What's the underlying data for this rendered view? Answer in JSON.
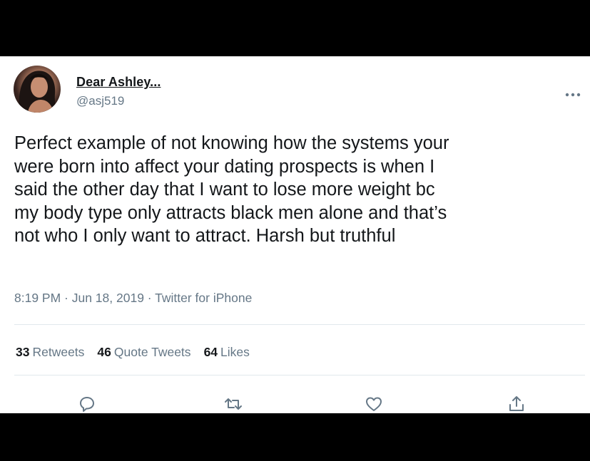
{
  "user": {
    "display_name": "Dear Ashley...",
    "handle": "@asj519"
  },
  "tweet": {
    "text": "Perfect example of not knowing how the systems your\nwere born into affect your dating prospects is when I\nsaid the other day that I want to lose more weight bc\nmy body type only attracts black men alone and that’s\nnot who I only want to attract. Harsh but truthful",
    "meta": "8:19 PM · Jun 18, 2019 · Twitter for iPhone"
  },
  "stats": {
    "retweets_count": "33",
    "retweets_label": "Retweets",
    "quotes_count": "46",
    "quotes_label": "Quote Tweets",
    "likes_count": "64",
    "likes_label": "Likes"
  },
  "icons": {
    "more": "more-icon",
    "reply": "reply-icon",
    "retweet": "retweet-icon",
    "like": "heart-icon",
    "share": "share-icon"
  },
  "colors": {
    "text_primary": "#14171a",
    "text_secondary": "#657786",
    "divider": "#e1e8ed",
    "background_frame": "#000000"
  }
}
